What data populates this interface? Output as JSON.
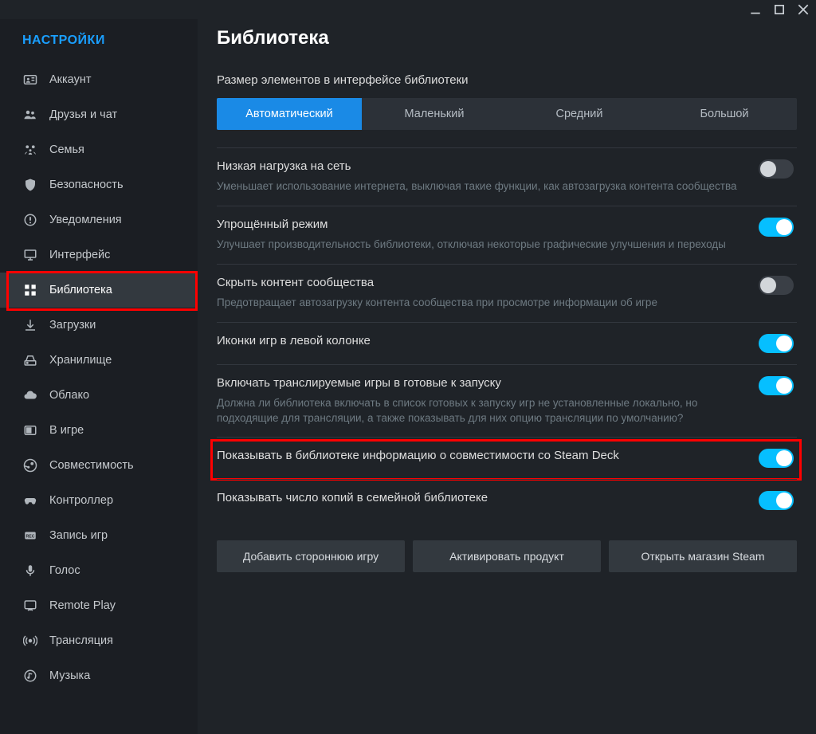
{
  "window": {
    "title": "Настройки"
  },
  "sidebar": {
    "title": "НАСТРОЙКИ",
    "items": [
      {
        "label": "Аккаунт"
      },
      {
        "label": "Друзья и чат"
      },
      {
        "label": "Семья"
      },
      {
        "label": "Безопасность"
      },
      {
        "label": "Уведомления"
      },
      {
        "label": "Интерфейс"
      },
      {
        "label": "Библиотека"
      },
      {
        "label": "Загрузки"
      },
      {
        "label": "Хранилище"
      },
      {
        "label": "Облако"
      },
      {
        "label": "В игре"
      },
      {
        "label": "Совместимость"
      },
      {
        "label": "Контроллер"
      },
      {
        "label": "Запись игр"
      },
      {
        "label": "Голос"
      },
      {
        "label": "Remote Play"
      },
      {
        "label": "Трансляция"
      },
      {
        "label": "Музыка"
      }
    ]
  },
  "page": {
    "title": "Библиотека",
    "size_section": {
      "label": "Размер элементов в интерфейсе библиотеки",
      "options": [
        "Автоматический",
        "Маленький",
        "Средний",
        "Большой"
      ]
    },
    "settings": [
      {
        "title": "Низкая нагрузка на сеть",
        "desc": "Уменьшает использование интернета, выключая такие функции, как автозагрузка контента сообщества",
        "on": false
      },
      {
        "title": "Упрощённый режим",
        "desc": "Улучшает производительность библиотеки, отключая некоторые графические улучшения и переходы",
        "on": true
      },
      {
        "title": "Скрыть контент сообщества",
        "desc": "Предотвращает автозагрузку контента сообщества при просмотре информации об игре",
        "on": false
      },
      {
        "title": "Иконки игр в левой колонке",
        "desc": "",
        "on": true
      },
      {
        "title": "Включать транслируемые игры в готовые к запуску",
        "desc": "Должна ли библиотека включать в список готовых к запуску игр не установленные локально, но подходящие для трансляции, а также показывать для них опцию трансляции по умолчанию?",
        "on": true
      },
      {
        "title": "Показывать в библиотеке информацию о совместимости со Steam Deck",
        "desc": "",
        "on": true
      },
      {
        "title": "Показывать число копий в семейной библиотеке",
        "desc": "",
        "on": true
      }
    ],
    "actions": {
      "add_nonsteam": "Добавить стороннюю игру",
      "activate_product": "Активировать продукт",
      "open_store": "Открыть магазин Steam"
    }
  }
}
